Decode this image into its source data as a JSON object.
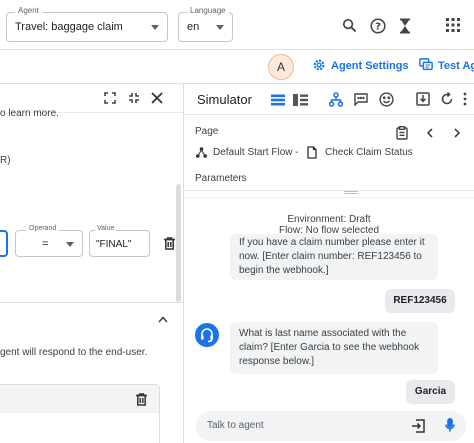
{
  "agent_select": {
    "label": "Agent",
    "value": "Travel: baggage claim"
  },
  "language_select": {
    "label": "Language",
    "value": "en"
  },
  "avatar_letter": "A",
  "agent_settings_label": "Agent Settings",
  "test_agent_label": "Test Age",
  "left_panel": {
    "learn_more_fragment": "o learn more.",
    "paren_fragment": "R)",
    "operand_label": "Operand",
    "operand_value": "=",
    "value_label": "Value",
    "value_value": "\"FINAL\"",
    "respond_text": "gent will respond to the end-user."
  },
  "simulator": {
    "title": "Simulator",
    "page_label": "Page",
    "start_flow": "Default Start Flow",
    "separator": "-",
    "page_name": "Check Claim Status",
    "parameters_label": "Parameters",
    "environment": "Environment: Draft",
    "flow": "Flow: No flow selected",
    "messages": [
      {
        "role": "agent",
        "text": "If you have a claim number please enter it now. [Enter claim number: REF123456 to begin the webhook.]"
      },
      {
        "role": "user",
        "text": "REF123456"
      },
      {
        "role": "agent",
        "text": "What is last name associated with the claim? [Enter Garcia to see the webhook response below.]"
      },
      {
        "role": "user",
        "text": "Garcia"
      }
    ],
    "input_placeholder": "Talk to agent"
  },
  "colors": {
    "accent": "#1a73e8",
    "border": "#dadce0",
    "bubble": "#f1f3f4"
  }
}
